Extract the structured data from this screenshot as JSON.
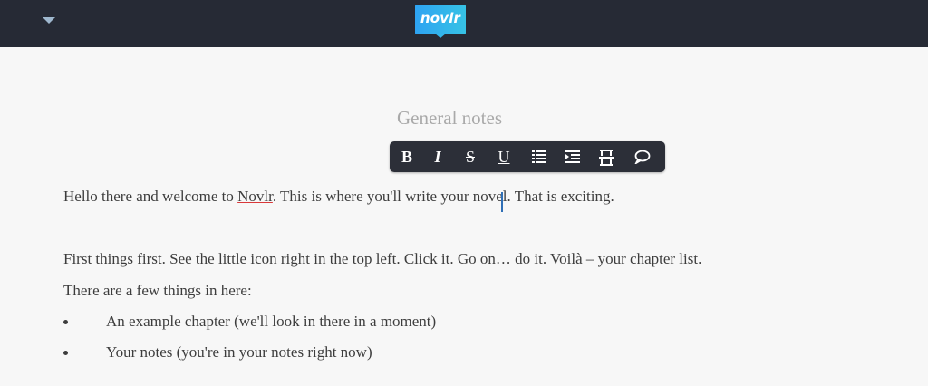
{
  "app": {
    "logo_text": "novlr",
    "brand_color": "#2ea3f2",
    "topbar_color": "#262a35",
    "menu_icon": "chevron-down-icon"
  },
  "document": {
    "title": "General notes"
  },
  "toolbar": {
    "buttons": [
      {
        "name": "bold",
        "label": "B",
        "icon": "bold-icon"
      },
      {
        "name": "italic",
        "label": "I",
        "icon": "italic-icon"
      },
      {
        "name": "strikethrough",
        "label": "S",
        "icon": "strikethrough-icon"
      },
      {
        "name": "underline",
        "label": "U",
        "icon": "underline-icon"
      },
      {
        "name": "list",
        "label": "",
        "icon": "list-icon"
      },
      {
        "name": "indent",
        "label": "",
        "icon": "indent-icon"
      },
      {
        "name": "scene-break",
        "label": "",
        "icon": "scene-break-icon"
      },
      {
        "name": "comment",
        "label": "",
        "icon": "comment-icon"
      }
    ]
  },
  "content": {
    "p1_before": "Hello there and welcome to ",
    "p1_link": "Novlr",
    "p1_after": ". This is where you'll write your novel. That is exciting.",
    "p2_before": "First things first. See the little icon right in the top left. Click it. Go on… do it. ",
    "p2_spell": "Voilà",
    "p2_after": " – your chapter list.",
    "p3": "There are a few things in here:",
    "bullets": [
      "An example chapter (we'll look in there in a moment)",
      "Your notes (you're in your notes right now)"
    ]
  }
}
